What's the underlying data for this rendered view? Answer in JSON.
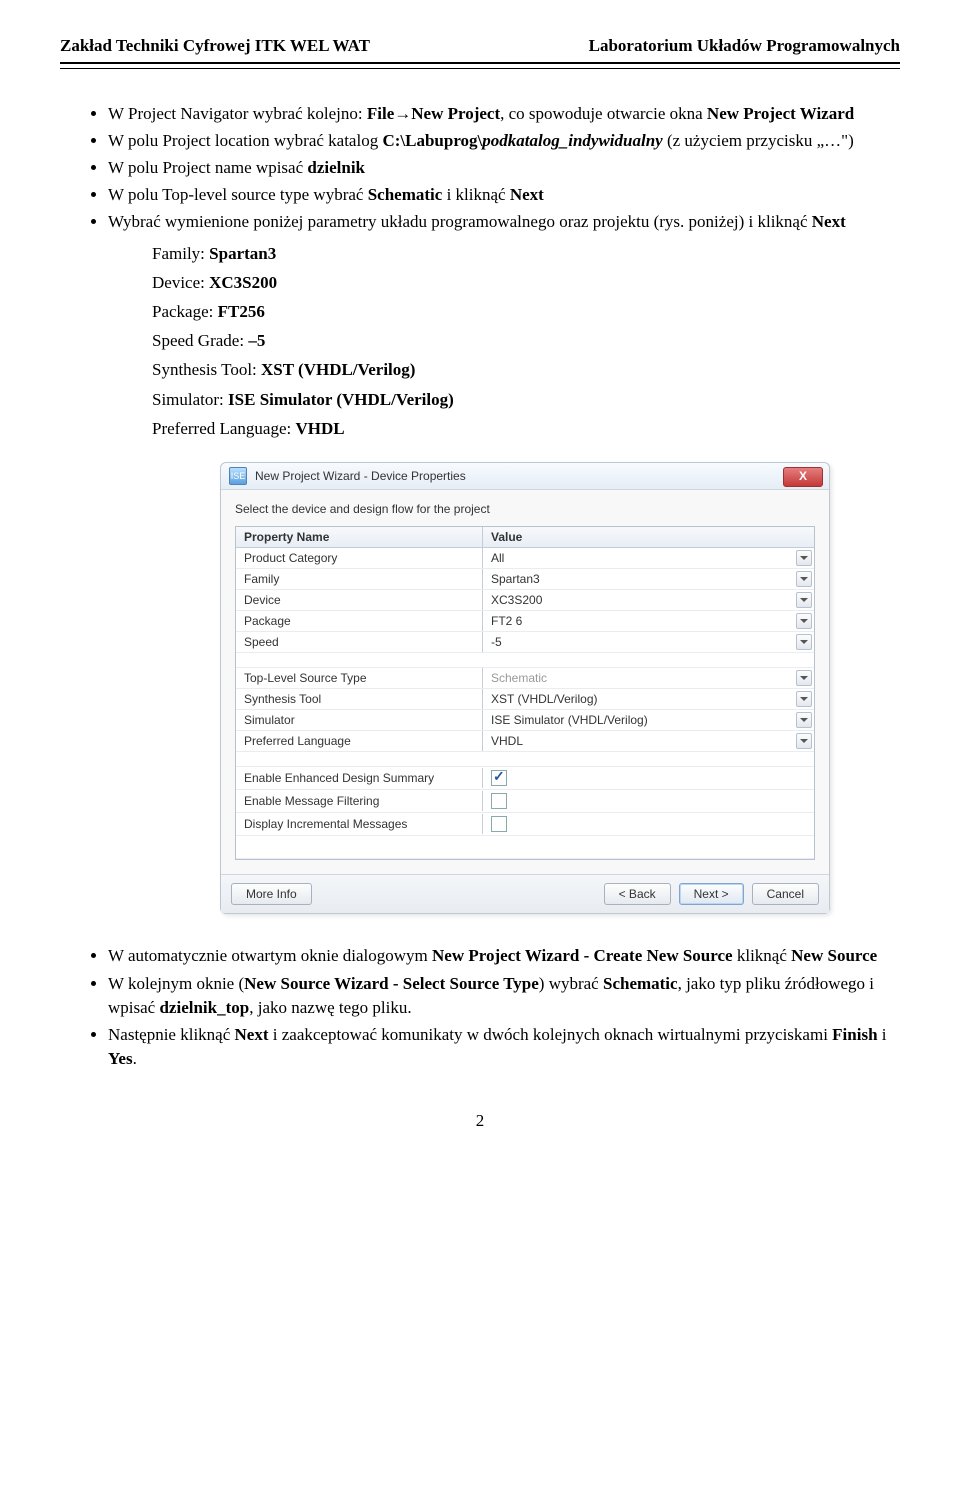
{
  "header": {
    "left": "Zakład Techniki Cyfrowej ITK WEL WAT",
    "right": "Laboratorium Układów Programowalnych"
  },
  "bullets1": {
    "a": {
      "pre": "W Project Navigator wybrać kolejno: ",
      "b1": "File→New Project",
      "mid": ", co spowoduje otwarcie okna ",
      "b2": "New Project Wizard"
    },
    "b": {
      "pre": "W polu Project location wybrać katalog ",
      "path_prefix": "C:\\Labuprog\\",
      "path_var": "podkatalog_indywidualny",
      "post": " (z użyciem przycisku „…\")"
    },
    "c": {
      "pre": "W polu Project name wpisać ",
      "b1": "dzielnik"
    },
    "d": {
      "pre": "W polu Top-level source type wybrać ",
      "b1": "Schematic",
      "mid": " i kliknąć ",
      "b2": "Next"
    },
    "e": {
      "pre": "Wybrać wymienione poniżej parametry układu programowalnego oraz projektu (rys. poniżej) i kliknąć ",
      "b1": "Next"
    }
  },
  "params": {
    "family": {
      "label": "Family: ",
      "val": "Spartan3"
    },
    "device": {
      "label": "Device: ",
      "val": "XC3S200"
    },
    "package": {
      "label": "Package: ",
      "val": "FT256"
    },
    "speed": {
      "label": "Speed Grade: ",
      "val": "–5"
    },
    "synth": {
      "label": "Synthesis Tool: ",
      "val": "XST (VHDL/Verilog)"
    },
    "sim": {
      "label": "Simulator: ",
      "val": "ISE Simulator (VHDL/Verilog)"
    },
    "lang": {
      "label": "Preferred Language: ",
      "val": "VHDL"
    }
  },
  "dialog": {
    "title": "New Project Wizard - Device Properties",
    "subtitle": "Select the device and design flow for the project",
    "col1": "Property Name",
    "col2": "Value",
    "rows": {
      "cat": {
        "n": "Product Category",
        "v": "All",
        "dd": true
      },
      "fam": {
        "n": "Family",
        "v": "Spartan3",
        "dd": true
      },
      "dev": {
        "n": "Device",
        "v": "XC3S200",
        "dd": true
      },
      "pkg": {
        "n": "Package",
        "v": "FT2 6",
        "dd": true
      },
      "spd": {
        "n": "Speed",
        "v": "-5",
        "dd": true
      },
      "tls": {
        "n": "Top-Level Source Type",
        "v": "Schematic",
        "dd": true,
        "disabled": true
      },
      "syn": {
        "n": "Synthesis Tool",
        "v": "XST (VHDL/Verilog)",
        "dd": true
      },
      "simr": {
        "n": "Simulator",
        "v": "ISE Simulator (VHDL/Verilog)",
        "dd": true
      },
      "plang": {
        "n": "Preferred Language",
        "v": "VHDL",
        "dd": true
      },
      "eeds": {
        "n": "Enable Enhanced Design Summary",
        "checked": true
      },
      "emf": {
        "n": "Enable Message Filtering",
        "checked": false
      },
      "dim": {
        "n": "Display Incremental Messages",
        "checked": false
      }
    },
    "buttons": {
      "more": "More Info",
      "back": "< Back",
      "next": "Next >",
      "cancel": "Cancel"
    },
    "close": "X"
  },
  "bullets2": {
    "a": {
      "pre": "W automatycznie otwartym oknie dialogowym ",
      "b1": "New Project Wizard - Create New Source",
      "mid": " kliknąć ",
      "b2": "New Source"
    },
    "b": {
      "pre": "W kolejnym oknie (",
      "b1": "New Source Wizard - Select Source Type",
      "mid1": ") wybrać ",
      "b2": "Schematic",
      "mid2": ", jako typ pliku źródłowego i wpisać ",
      "b3": "dzielnik_top",
      "post": ", jako nazwę tego pliku."
    },
    "c": {
      "pre": "Następnie kliknąć ",
      "b1": "Next",
      "mid": " i zaakceptować komunikaty w dwóch kolejnych oknach wirtualnymi przyciskami ",
      "b2": "Finish",
      "and": " i ",
      "b3": "Yes",
      "dot": "."
    }
  },
  "pagenum": "2"
}
